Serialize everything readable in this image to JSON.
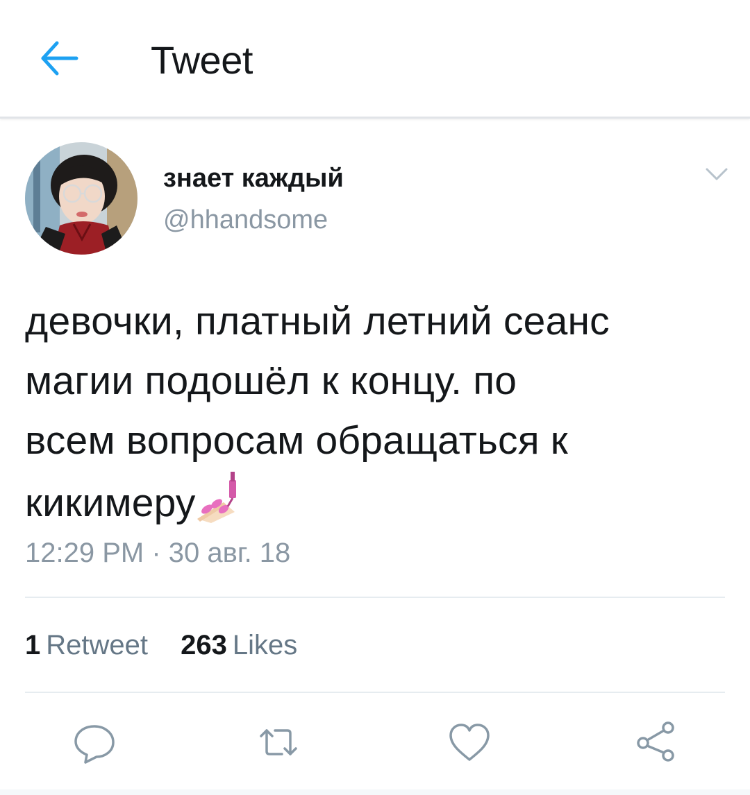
{
  "header": {
    "title": "Tweet",
    "back_icon": "arrow-left-icon",
    "accent_color": "#1da1f2"
  },
  "author": {
    "display_name": "знает каждый",
    "handle": "@hhandsome"
  },
  "tweet": {
    "text": "девочки, платный летний сеанс\nмагии подошёл к концу. по\nвсем вопросам обращаться к\nкикимеру",
    "emoji": "nail-polish-emoji",
    "timestamp": "12:29 PM · 30 авг. 18"
  },
  "stats": {
    "retweets_count": "1",
    "retweets_label": "Retweet",
    "likes_count": "263",
    "likes_label": "Likes"
  },
  "actions": [
    {
      "icon": "reply-icon"
    },
    {
      "icon": "retweet-icon"
    },
    {
      "icon": "heart-icon"
    },
    {
      "icon": "share-icon"
    }
  ],
  "colors": {
    "text": "#14171a",
    "secondary": "#8a97a3",
    "divider": "#e6ecf0",
    "icon": "#8899a6"
  }
}
